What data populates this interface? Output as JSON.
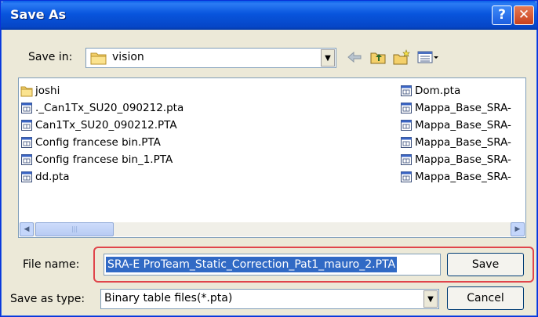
{
  "title": "Save As",
  "titlebar_buttons": {
    "help": "?",
    "close": "✕"
  },
  "save_in": {
    "label": "Save in:",
    "value": "vision"
  },
  "toolbar": {
    "icons": [
      "back-icon",
      "up-folder-icon",
      "new-folder-icon",
      "view-menu-icon"
    ]
  },
  "files": {
    "left": [
      {
        "name": "joshi",
        "type": "folder"
      },
      {
        "name": "._Can1Tx_SU20_090212.pta",
        "type": "pta"
      },
      {
        "name": "Can1Tx_SU20_090212.PTA",
        "type": "pta"
      },
      {
        "name": "Config francese bin.PTA",
        "type": "pta"
      },
      {
        "name": "Config francese bin_1.PTA",
        "type": "pta"
      },
      {
        "name": "dd.pta",
        "type": "pta"
      }
    ],
    "right": [
      {
        "name": "Dom.pta",
        "type": "pta"
      },
      {
        "name": "Mappa_Base_SRA-",
        "type": "pta"
      },
      {
        "name": "Mappa_Base_SRA-",
        "type": "pta"
      },
      {
        "name": "Mappa_Base_SRA-",
        "type": "pta"
      },
      {
        "name": "Mappa_Base_SRA-",
        "type": "pta"
      },
      {
        "name": "Mappa_Base_SRA-",
        "type": "pta"
      }
    ]
  },
  "file_name": {
    "label": "File name:",
    "value": "SRA-E ProTeam_Static_Correction_Pat1_mauro_2.PTA"
  },
  "save_as_type": {
    "label": "Save as type:",
    "value": "Binary table files(*.pta)"
  },
  "buttons": {
    "save": "Save",
    "cancel": "Cancel"
  },
  "colors": {
    "titlebar": "#0855dd",
    "selection": "#316AC5",
    "highlight_outline": "#e0454b"
  }
}
